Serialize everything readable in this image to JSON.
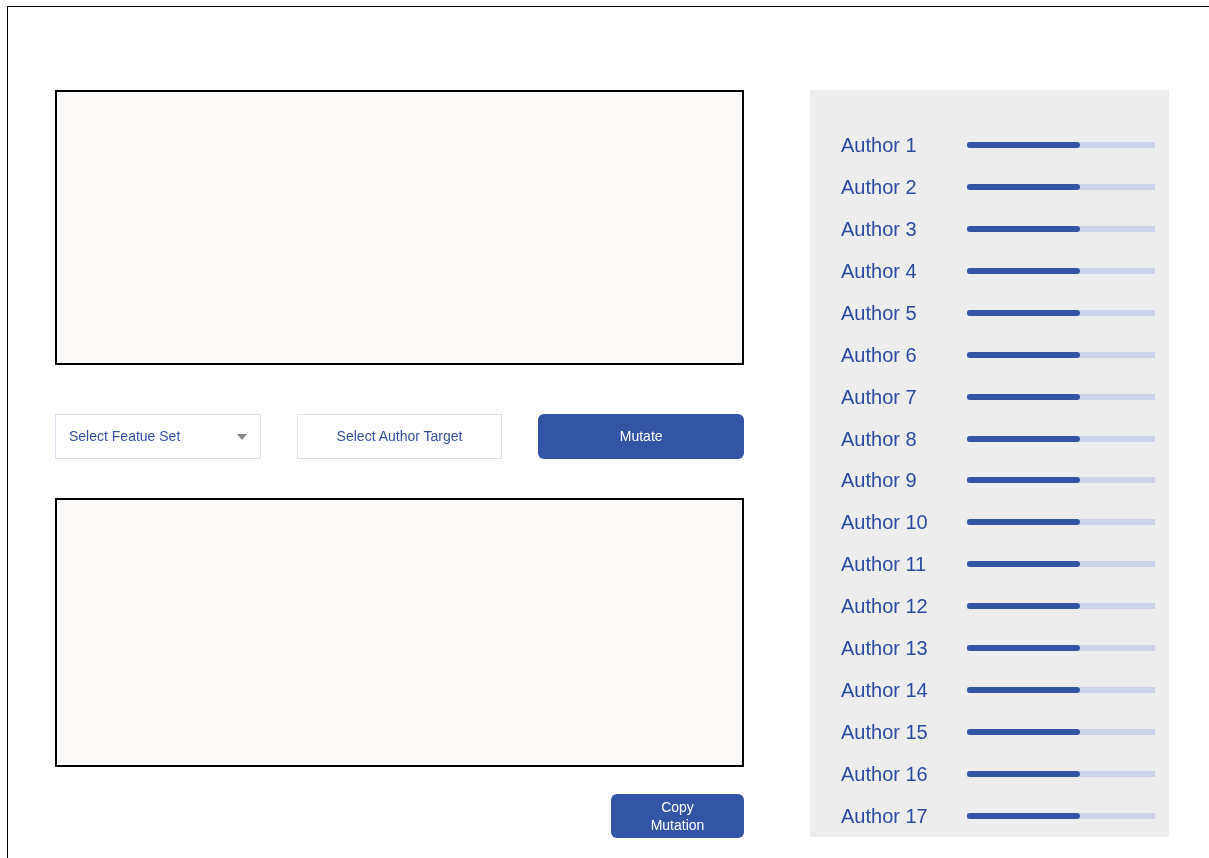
{
  "controls": {
    "feature_select": {
      "placeholder": "Select Featue Set"
    },
    "author_target": {
      "label": "Select Author Target"
    },
    "mutate_button": {
      "label": "Mutate"
    }
  },
  "copy_button": {
    "label": "Copy\nMutation"
  },
  "authors": [
    {
      "name": "Author 1",
      "level": 0.6
    },
    {
      "name": "Author 2",
      "level": 0.6
    },
    {
      "name": "Author 3",
      "level": 0.6
    },
    {
      "name": "Author 4",
      "level": 0.6
    },
    {
      "name": "Author 5",
      "level": 0.6
    },
    {
      "name": "Author 6",
      "level": 0.6
    },
    {
      "name": "Author 7",
      "level": 0.6
    },
    {
      "name": "Author 8",
      "level": 0.6
    },
    {
      "name": "Author 9",
      "level": 0.6
    },
    {
      "name": "Author 10",
      "level": 0.6
    },
    {
      "name": "Author 11",
      "level": 0.6
    },
    {
      "name": "Author 12",
      "level": 0.6
    },
    {
      "name": "Author 13",
      "level": 0.6
    },
    {
      "name": "Author 14",
      "level": 0.6
    },
    {
      "name": "Author 15",
      "level": 0.6
    },
    {
      "name": "Author 16",
      "level": 0.6
    },
    {
      "name": "Author 17",
      "level": 0.6
    }
  ]
}
